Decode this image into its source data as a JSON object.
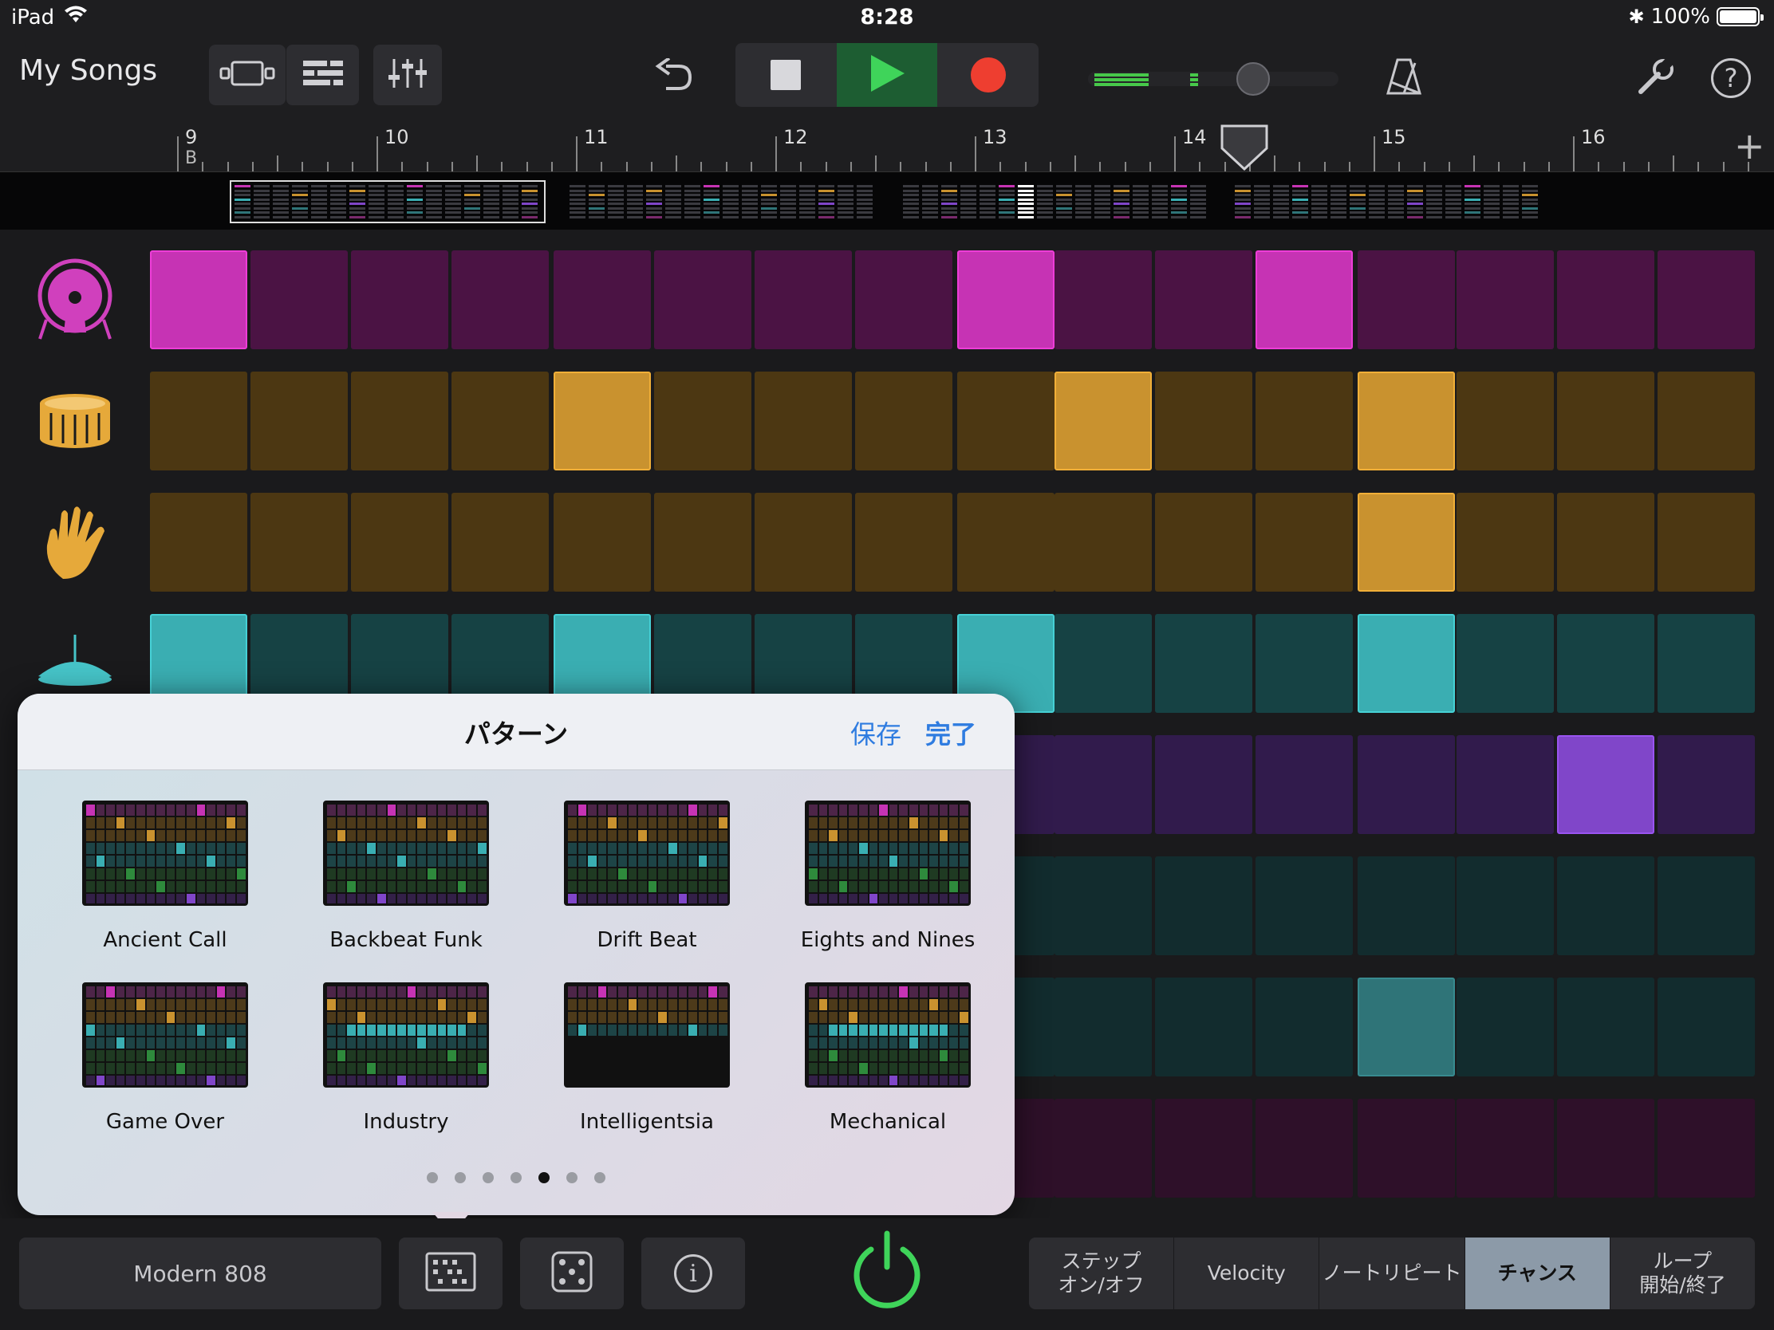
{
  "status_bar": {
    "device": "iPad",
    "time": "8:28",
    "battery": "100%"
  },
  "toolbar": {
    "my_songs": "My Songs",
    "icons": [
      "view-toggle-icon",
      "tracks-icon",
      "mixer-icon",
      "undo-icon",
      "stop-icon",
      "play-icon",
      "record-icon",
      "master-volume-slider",
      "metronome-icon",
      "settings-wrench-icon",
      "help-icon"
    ],
    "volume_level": 0.5
  },
  "ruler": {
    "bars": [
      "9",
      "10",
      "11",
      "12",
      "13",
      "14",
      "15",
      "16"
    ],
    "section": "B",
    "playhead_bar": 14.5
  },
  "grid": {
    "rows": [
      {
        "instrument": "kick-drum-icon",
        "color": "#c633b4",
        "active": [
          0,
          8,
          11
        ]
      },
      {
        "instrument": "snare-drum-icon",
        "color": "#c9922f",
        "active": [
          4,
          9,
          12
        ]
      },
      {
        "instrument": "clap-hand-icon",
        "color": "#c9922f",
        "active": [
          12
        ]
      },
      {
        "instrument": "cymbal-icon",
        "color": "#3aaeb2",
        "active": [
          0,
          4,
          8,
          12
        ]
      },
      {
        "instrument": "",
        "color": "#8046c9",
        "active": [
          14
        ]
      },
      {
        "instrument": "",
        "color": "#2f7478",
        "active": []
      },
      {
        "instrument": "",
        "color": "#2f7478",
        "active": [
          12
        ]
      },
      {
        "instrument": "",
        "color": "#7a2a6d",
        "active": []
      }
    ],
    "steps": 16
  },
  "popover": {
    "title": "パターン",
    "save": "保存",
    "done": "完了",
    "patterns": [
      {
        "name": "Ancient Call"
      },
      {
        "name": "Backbeat Funk"
      },
      {
        "name": "Drift Beat"
      },
      {
        "name": "Eights and Nines"
      },
      {
        "name": "Game Over"
      },
      {
        "name": "Industry"
      },
      {
        "name": "Intelligentsia"
      },
      {
        "name": "Mechanical"
      }
    ],
    "page_count": 7,
    "current_page": 5
  },
  "bottom_bar": {
    "kit_name": "Modern 808",
    "icons": [
      "pattern-grid-icon",
      "dice-icon",
      "info-icon",
      "power-icon"
    ],
    "modes": [
      {
        "label": "ステップ\nオン/オフ",
        "selected": false
      },
      {
        "label": "Velocity",
        "selected": false
      },
      {
        "label": "ノートリピート",
        "selected": false
      },
      {
        "label": "チャンス",
        "selected": true
      },
      {
        "label": "ループ\n開始/終了",
        "selected": false
      }
    ]
  }
}
